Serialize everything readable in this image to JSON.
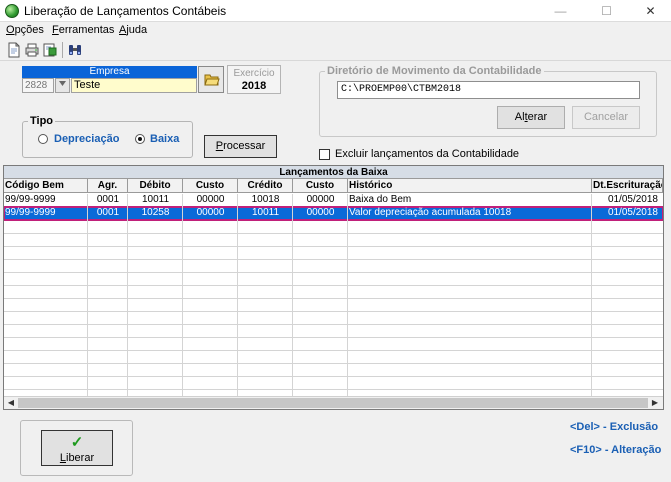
{
  "window": {
    "title": "Liberação de Lançamentos Contábeis",
    "min_glyph": "—",
    "max_glyph": "☐",
    "close_glyph": "✕"
  },
  "menu": [
    {
      "label": "Opções",
      "accel": "O"
    },
    {
      "label": "Ferramentas",
      "accel": "F"
    },
    {
      "label": "Ajuda",
      "accel": "A"
    }
  ],
  "toolbar": {
    "icons": [
      "new-document-icon",
      "print-preview-icon",
      "export-icon",
      "binoculars-icon"
    ]
  },
  "empresa": {
    "header": "Empresa",
    "code": "2828",
    "name": "Teste"
  },
  "exercicio": {
    "label": "Exercício",
    "value": "2018"
  },
  "tipo": {
    "label": "Tipo",
    "options": [
      {
        "label": "Depreciação",
        "selected": false
      },
      {
        "label": "Baixa",
        "selected": true
      }
    ]
  },
  "processar_label": "Processar",
  "diretorio": {
    "label": "Diretório de Movimento da Contabilidade",
    "path": "C:\\PROEMP00\\CTBM2018",
    "alterar_label": "Alterar",
    "cancelar_label": "Cancelar"
  },
  "excluir": {
    "label": "Excluir lançamentos da Contabilidade",
    "checked": false
  },
  "grid": {
    "title": "Lançamentos da Baixa",
    "columns": [
      "Código Bem",
      "Agr.",
      "Débito",
      "Custo",
      "Crédito",
      "Custo",
      "Histórico",
      "Dt.Escrituração"
    ],
    "rows": [
      [
        "99/99-9999",
        "0001",
        "10011",
        "00000",
        "10018",
        "00000",
        "Baixa do Bem",
        "01/05/2018"
      ],
      [
        "99/99-9999",
        "0001",
        "10258",
        "00000",
        "10011",
        "00000",
        "Valor depreciação acumulada 10018",
        "01/05/2018"
      ]
    ],
    "selected_row": 1
  },
  "liberar_label": "Liberar",
  "hints": {
    "del": "<Del> - Exclusão",
    "f10": "<F10> - Alteração"
  },
  "colors": {
    "selection": "#0a6ad8",
    "selection_outline": "#c0207a",
    "accent_text": "#1a5fb4",
    "empresa_bg": "#fffccc"
  }
}
